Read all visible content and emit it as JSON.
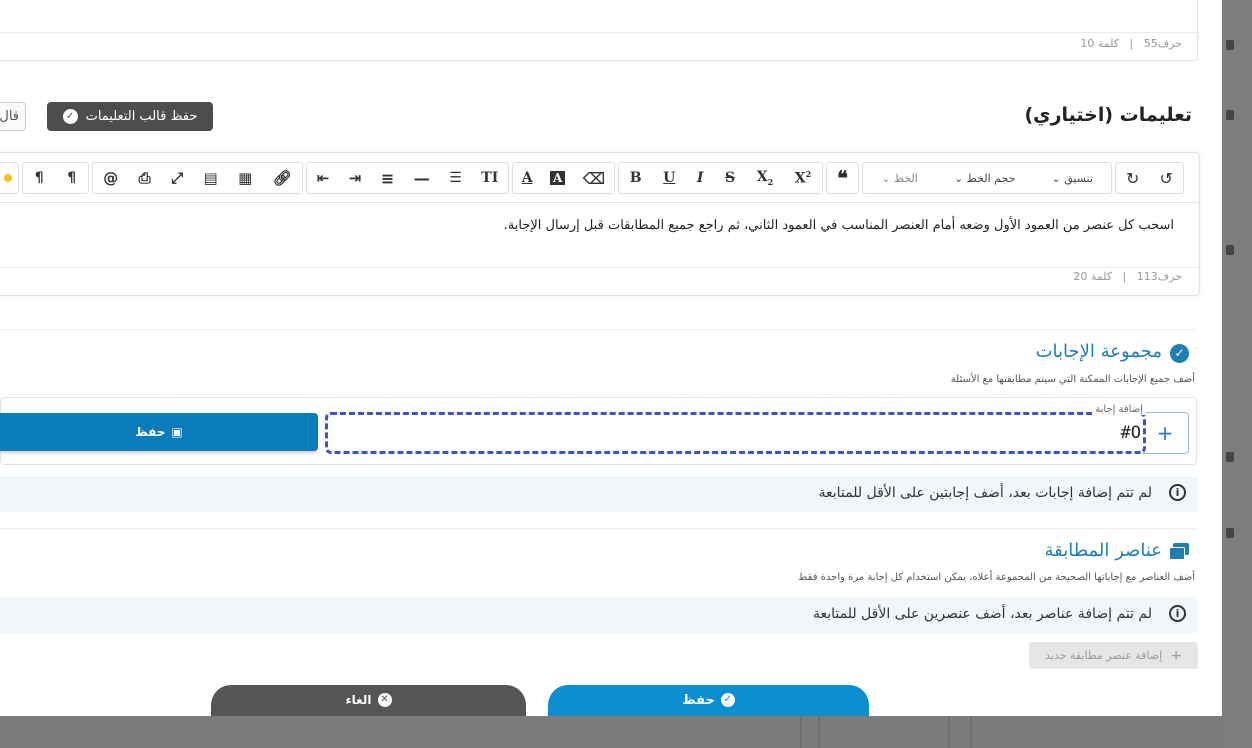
{
  "top_editor": {
    "counter_chars": "حرف55",
    "counter_sep": "|",
    "counter_words": "كلمة 10"
  },
  "instructions": {
    "title": "تعليمات (اختياري)",
    "save_template_label": "حفظ قالب التعليمات",
    "template_partial_label": "قال",
    "toolbar": {
      "format_label": "تنسيق",
      "font_size_label": "حجم الخط",
      "font_label": "الخط",
      "bold": "B",
      "underline": "U",
      "italic": "I",
      "strike": "S",
      "subscript": "X",
      "superscript": "X",
      "text_size": "TI"
    },
    "body_text": "اسحب كل عنصر من العمود الأول وضعه أمام العنصر المناسب في العمود الثاني، ثم راجع جميع المطابقات قبل إرسال الإجابة.",
    "counter_chars": "حرف113",
    "counter_sep": "|",
    "counter_words": "كلمة 20"
  },
  "answers": {
    "title": "مجموعة الإجابات",
    "description": "أضف جميع الإجابات الممكنة التي سيتم مطابقتها مع الأسئلة",
    "input_label": "إضافة إجابة",
    "input_value": "#O",
    "save_label": "حفظ",
    "empty_message": "لم تتم إضافة إجابات بعد، أضف إجابتين على الأقل للمتابعة"
  },
  "matching": {
    "title": "عناصر المطابقة",
    "description": "أضف العناصر مع إجاباتها الصحيحة من المجموعة أعلاه، يمكن استخدام كل إجابة مرة واحدة فقط",
    "empty_message": "لم تتم إضافة عناصر بعد، أضف عنصرين على الأقل للمتابعة",
    "add_label": "إضافة عنصر مطابقة جديد"
  },
  "footer": {
    "save_label": "حفظ",
    "cancel_label": "الغاء"
  },
  "colors": {
    "accent": "#1e7fb5",
    "primary_button": "#0b8fd0",
    "dark_button": "#555555",
    "save_template_bg": "#4d4d4d"
  }
}
